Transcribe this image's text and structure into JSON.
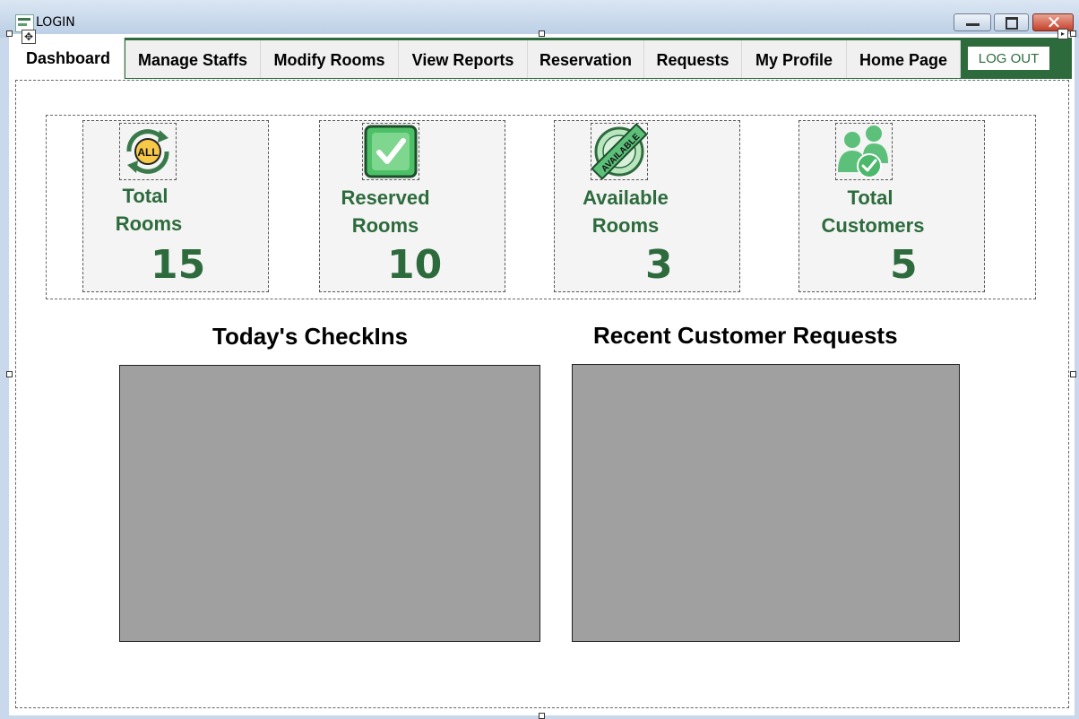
{
  "window": {
    "title": "LOGIN"
  },
  "tabs": [
    {
      "label": "Dashboard",
      "active": true
    },
    {
      "label": "Manage Staffs"
    },
    {
      "label": "Modify Rooms"
    },
    {
      "label": "View Reports"
    },
    {
      "label": "Reservation"
    },
    {
      "label": "Requests"
    },
    {
      "label": "My Profile"
    },
    {
      "label": "Home Page"
    }
  ],
  "logout_label": "LOG OUT",
  "stats": [
    {
      "line1": "Total",
      "line2": "Rooms",
      "value": "15",
      "icon": "all-rooms-icon"
    },
    {
      "line1": "Reserved",
      "line2": "Rooms",
      "value": "10",
      "icon": "checkmark-icon"
    },
    {
      "line1": "Available",
      "line2": "Rooms",
      "value": "3",
      "icon": "available-badge-icon"
    },
    {
      "line1": "Total",
      "line2": "Customers",
      "value": "5",
      "icon": "customers-icon"
    }
  ],
  "sections": {
    "checkins_title": "Today's CheckIns",
    "requests_title": "Recent Customer Requests"
  },
  "icon_badges": {
    "all": "ALL",
    "available": "AVAILABLE"
  },
  "colors": {
    "accent": "#2d6b3d",
    "grid": "#a0a0a0",
    "card": "#f4f4f4"
  }
}
